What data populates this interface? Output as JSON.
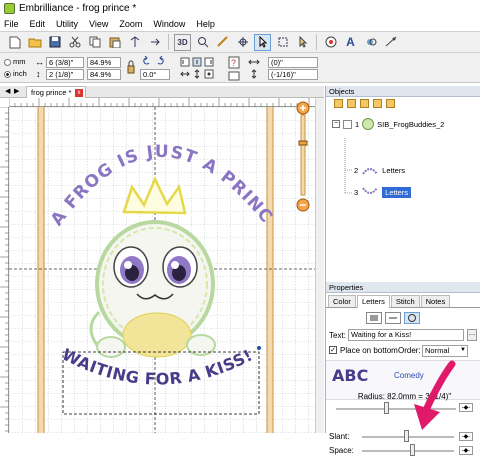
{
  "app": {
    "title": "Embrilliance - frog prince *"
  },
  "menu": [
    "File",
    "Edit",
    "Utility",
    "View",
    "Zoom",
    "Window",
    "Help"
  ],
  "toolbar": {
    "three_d_label": "3D"
  },
  "edit_bar": {
    "unit_mm": "mm",
    "unit_inch": "inch",
    "width_value": "6 (3/8)\"",
    "height_value": "2 (1/8)\"",
    "width_pct": "84.9%",
    "height_pct": "84.9%",
    "rotation": "0.0°",
    "x_pos": "(0)\"",
    "y_pos": "(-1/16)\""
  },
  "doc_tab": {
    "label": "frog prince *",
    "close": "x"
  },
  "design": {
    "arc_text": "A FROG IS JUST A PRINCE",
    "bottom_text": "WAITING FOR A KISS!",
    "text_color": "#8a74c4"
  },
  "objects_panel": {
    "title": "Objects",
    "items": [
      {
        "num": "1",
        "label": "SIB_FrogBuddies_2"
      },
      {
        "num": "2",
        "label": "Letters"
      },
      {
        "num": "3",
        "label": "Letters"
      }
    ]
  },
  "properties_panel": {
    "title": "Properties",
    "tabs": [
      "Color",
      "Letters",
      "Stitch",
      "Notes"
    ],
    "text_label": "Text:",
    "text_value": "Waiting for a Kiss!",
    "place_on_bottom": "Place on bottom",
    "order_label": "Order:",
    "order_value": "Normal",
    "font_preview": "ABC",
    "font_name": "Comedy",
    "radius_label": "Radius: 82.0mm = 3 (1/4)\"",
    "slant_label": "Slant:",
    "space_label": "Space:"
  },
  "colors": {
    "accent": "#6b9ed6",
    "arrow": "#e0196a",
    "selection": "#2f6bd3"
  }
}
